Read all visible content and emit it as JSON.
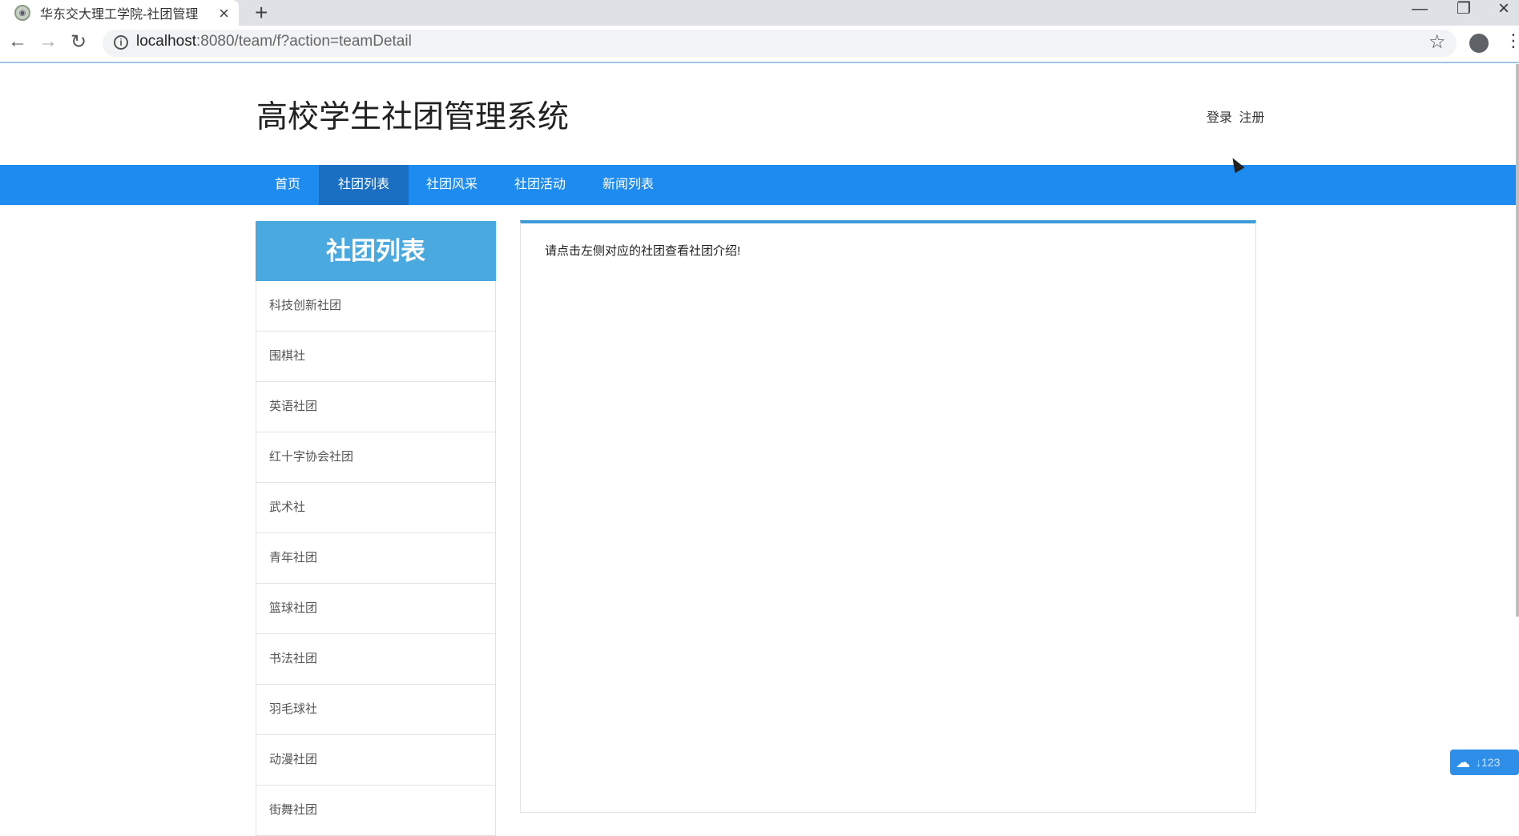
{
  "browser": {
    "tab_title": "华东交大理工学院-社团管理",
    "url_host": "localhost",
    "url_rest": ":8080/team/f?action=teamDetail"
  },
  "header": {
    "site_title": "高校学生社团管理系统",
    "login": "登录",
    "register": "注册"
  },
  "nav": {
    "items": [
      "首页",
      "社团列表",
      "社团风采",
      "社团活动",
      "新闻列表"
    ],
    "active_index": 1
  },
  "sidebar": {
    "title": "社团列表",
    "items": [
      "科技创新社团",
      "围棋社",
      "英语社团",
      "红十字协会社团",
      "武术社",
      "青年社团",
      "篮球社团",
      "书法社团",
      "羽毛球社",
      "动漫社团",
      "街舞社团"
    ]
  },
  "content": {
    "message": "请点击左侧对应的社团查看社团介绍!"
  },
  "widget": {
    "label": "123"
  },
  "colors": {
    "navbar": "#1e8bf0",
    "nav_active": "#1a6fc2",
    "sidebar_header": "#4aa9df",
    "content_border_top": "#3e9ad6"
  }
}
